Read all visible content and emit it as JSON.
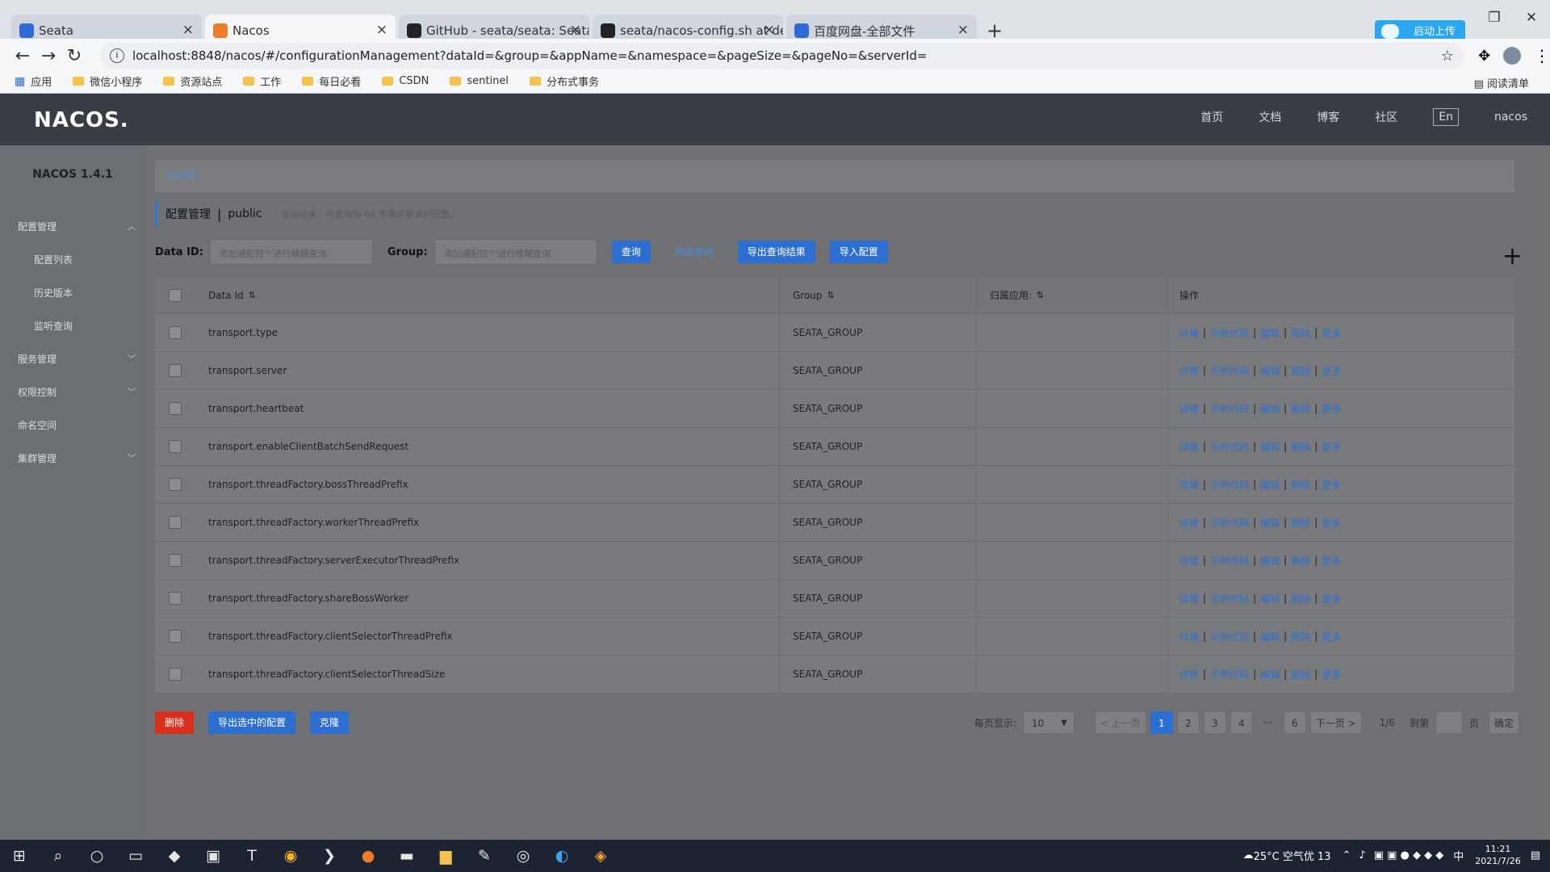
{
  "browser": {
    "tabs": [
      {
        "label": "Seata",
        "icon": "seata-icon",
        "color": "#2f6bd6",
        "active": false
      },
      {
        "label": "Nacos",
        "icon": "nacos-icon",
        "color": "#ef7d2e",
        "active": true
      },
      {
        "label": "GitHub - seata/seata: Seata is",
        "icon": "github-icon",
        "color": "#222222",
        "active": false
      },
      {
        "label": "seata/nacos-config.sh at devel",
        "icon": "github-icon",
        "color": "#222222",
        "active": false
      },
      {
        "label": "百度网盘-全部文件",
        "icon": "baidu-icon",
        "color": "#2f6bd6",
        "active": false
      }
    ],
    "upload_label": "启动上传",
    "url": "localhost:8848/nacos/#/configurationManagement?dataId=&group=&appName=&namespace=&pageSize=&pageNo=&serverId=",
    "bookmarks": [
      "应用",
      "微信小程序",
      "资源站点",
      "工作",
      "每日必看",
      "CSDN",
      "sentinel",
      "分布式事务"
    ],
    "reading_list": "阅读清单"
  },
  "header": {
    "logo": "NACOS.",
    "nav": [
      "首页",
      "文档",
      "博客",
      "社区"
    ],
    "lang": "En",
    "user": "nacos"
  },
  "sidebar": {
    "version": "NACOS 1.4.1",
    "items": [
      {
        "label": "配置管理",
        "type": "group"
      },
      {
        "label": "配置列表",
        "type": "sub"
      },
      {
        "label": "历史版本",
        "type": "sub"
      },
      {
        "label": "监听查询",
        "type": "sub"
      },
      {
        "label": "服务管理",
        "type": "group"
      },
      {
        "label": "权限控制",
        "type": "group"
      },
      {
        "label": "命名空间",
        "type": "plain"
      },
      {
        "label": "集群管理",
        "type": "group"
      }
    ]
  },
  "main": {
    "namespace": "public",
    "title": "配置管理",
    "title_ns": "public",
    "hint": "查询结果：共查询到 60 条满足要求的配置。",
    "filter": {
      "dataid_label": "Data ID:",
      "dataid_placeholder": "添加通配符'*'进行模糊查询",
      "group_label": "Group:",
      "group_placeholder": "添加通配符'*'进行模糊查询",
      "query": "查询",
      "advanced": "高级查询",
      "export": "导出查询结果",
      "import": "导入配置"
    },
    "table": {
      "headers": [
        "Data Id",
        "Group",
        "归属应用:",
        "操作"
      ],
      "ops": [
        "详情",
        "示例代码",
        "编辑",
        "删除",
        "更多"
      ],
      "rows": [
        {
          "id": "transport.type",
          "group": "SEATA_GROUP"
        },
        {
          "id": "transport.server",
          "group": "SEATA_GROUP"
        },
        {
          "id": "transport.heartbeat",
          "group": "SEATA_GROUP"
        },
        {
          "id": "transport.enableClientBatchSendRequest",
          "group": "SEATA_GROUP"
        },
        {
          "id": "transport.threadFactory.bossThreadPrefix",
          "group": "SEATA_GROUP"
        },
        {
          "id": "transport.threadFactory.workerThreadPrefix",
          "group": "SEATA_GROUP"
        },
        {
          "id": "transport.threadFactory.serverExecutorThreadPrefix",
          "group": "SEATA_GROUP"
        },
        {
          "id": "transport.threadFactory.shareBossWorker",
          "group": "SEATA_GROUP"
        },
        {
          "id": "transport.threadFactory.clientSelectorThreadPrefix",
          "group": "SEATA_GROUP"
        },
        {
          "id": "transport.threadFactory.clientSelectorThreadSize",
          "group": "SEATA_GROUP"
        }
      ]
    },
    "bottom": {
      "delete": "删除",
      "export_selected": "导出选中的配置",
      "clone": "克隆"
    },
    "pager": {
      "size_label": "每页显示:",
      "size": "10",
      "prev": "< 上一页",
      "pages": [
        "1",
        "2",
        "3",
        "4",
        "···",
        "6"
      ],
      "next": "下一页 >",
      "total": "1/6",
      "goto": "到第",
      "page": "页",
      "confirm": "确定"
    }
  },
  "taskbar": {
    "weather": "25°C 空气优 13",
    "ime": "中",
    "time": "11:21",
    "date": "2021/7/26"
  },
  "colors": {
    "primary": "#2c6fd0",
    "danger": "#d9301e",
    "header": "#3a3d43"
  }
}
